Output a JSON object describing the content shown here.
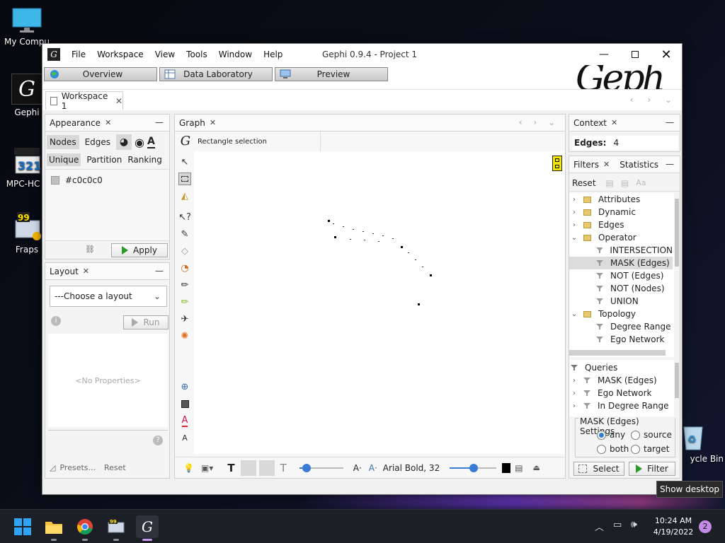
{
  "desktop": {
    "icons": [
      {
        "label": "My Compu"
      },
      {
        "label": "Gephi"
      },
      {
        "label": "MPC-HC x"
      },
      {
        "label": "Fraps"
      },
      {
        "label": "ycle Bin"
      }
    ],
    "tooltip": "Show desktop"
  },
  "window": {
    "title": "Gephi 0.9.4 - Project 1",
    "menu": [
      "File",
      "Workspace",
      "View",
      "Tools",
      "Window",
      "Help"
    ],
    "modes": [
      "Overview",
      "Data Laboratory",
      "Preview"
    ],
    "workspace_tab": "Workspace 1",
    "brand_text": "Gephi"
  },
  "appearance": {
    "tab": "Appearance",
    "element_tabs": [
      "Nodes",
      "Edges"
    ],
    "mode_tabs": [
      "Unique",
      "Partition",
      "Ranking"
    ],
    "color_value": "#c0c0c0",
    "apply_label": "Apply"
  },
  "layout": {
    "tab": "Layout",
    "choose_placeholder": "---Choose a layout",
    "run_label": "Run",
    "no_properties": "<No Properties>",
    "presets_label": "Presets...",
    "reset_label": "Reset"
  },
  "graph": {
    "tab": "Graph",
    "tool_label": "Rectangle selection",
    "font_label": "Arial Bold, 32"
  },
  "context": {
    "tab": "Context",
    "edges_label": "Edges:",
    "edges_value": "4"
  },
  "filters": {
    "tab": "Filters",
    "statistics_tab": "Statistics",
    "reset_label": "Reset",
    "tree": [
      {
        "label": "Attributes",
        "type": "folder",
        "level": 0,
        "expanded": false
      },
      {
        "label": "Dynamic",
        "type": "folder",
        "level": 0,
        "expanded": false
      },
      {
        "label": "Edges",
        "type": "folder",
        "level": 0,
        "expanded": false
      },
      {
        "label": "Operator",
        "type": "folder",
        "level": 0,
        "expanded": true
      },
      {
        "label": "INTERSECTION",
        "type": "filter",
        "level": 1
      },
      {
        "label": "MASK (Edges)",
        "type": "filter",
        "level": 1,
        "selected": true
      },
      {
        "label": "NOT (Edges)",
        "type": "filter",
        "level": 1
      },
      {
        "label": "NOT (Nodes)",
        "type": "filter",
        "level": 1
      },
      {
        "label": "UNION",
        "type": "filter",
        "level": 1
      },
      {
        "label": "Topology",
        "type": "folder",
        "level": 0,
        "expanded": true
      },
      {
        "label": "Degree Range",
        "type": "filter",
        "level": 1
      },
      {
        "label": "Ego Network",
        "type": "filter",
        "level": 1
      }
    ],
    "queries_label": "Queries",
    "queries": [
      "MASK (Edges)",
      "Ego Network",
      "In Degree Range"
    ],
    "settings_title": "MASK (Edges) Settings",
    "options": [
      {
        "label": "any",
        "checked": true
      },
      {
        "label": "source",
        "checked": false
      },
      {
        "label": "both",
        "checked": false
      },
      {
        "label": "target",
        "checked": false
      }
    ],
    "select_label": "Select",
    "filter_label": "Filter"
  },
  "taskbar": {
    "time": "10:24 AM",
    "date": "4/19/2022",
    "notification_count": "2"
  }
}
